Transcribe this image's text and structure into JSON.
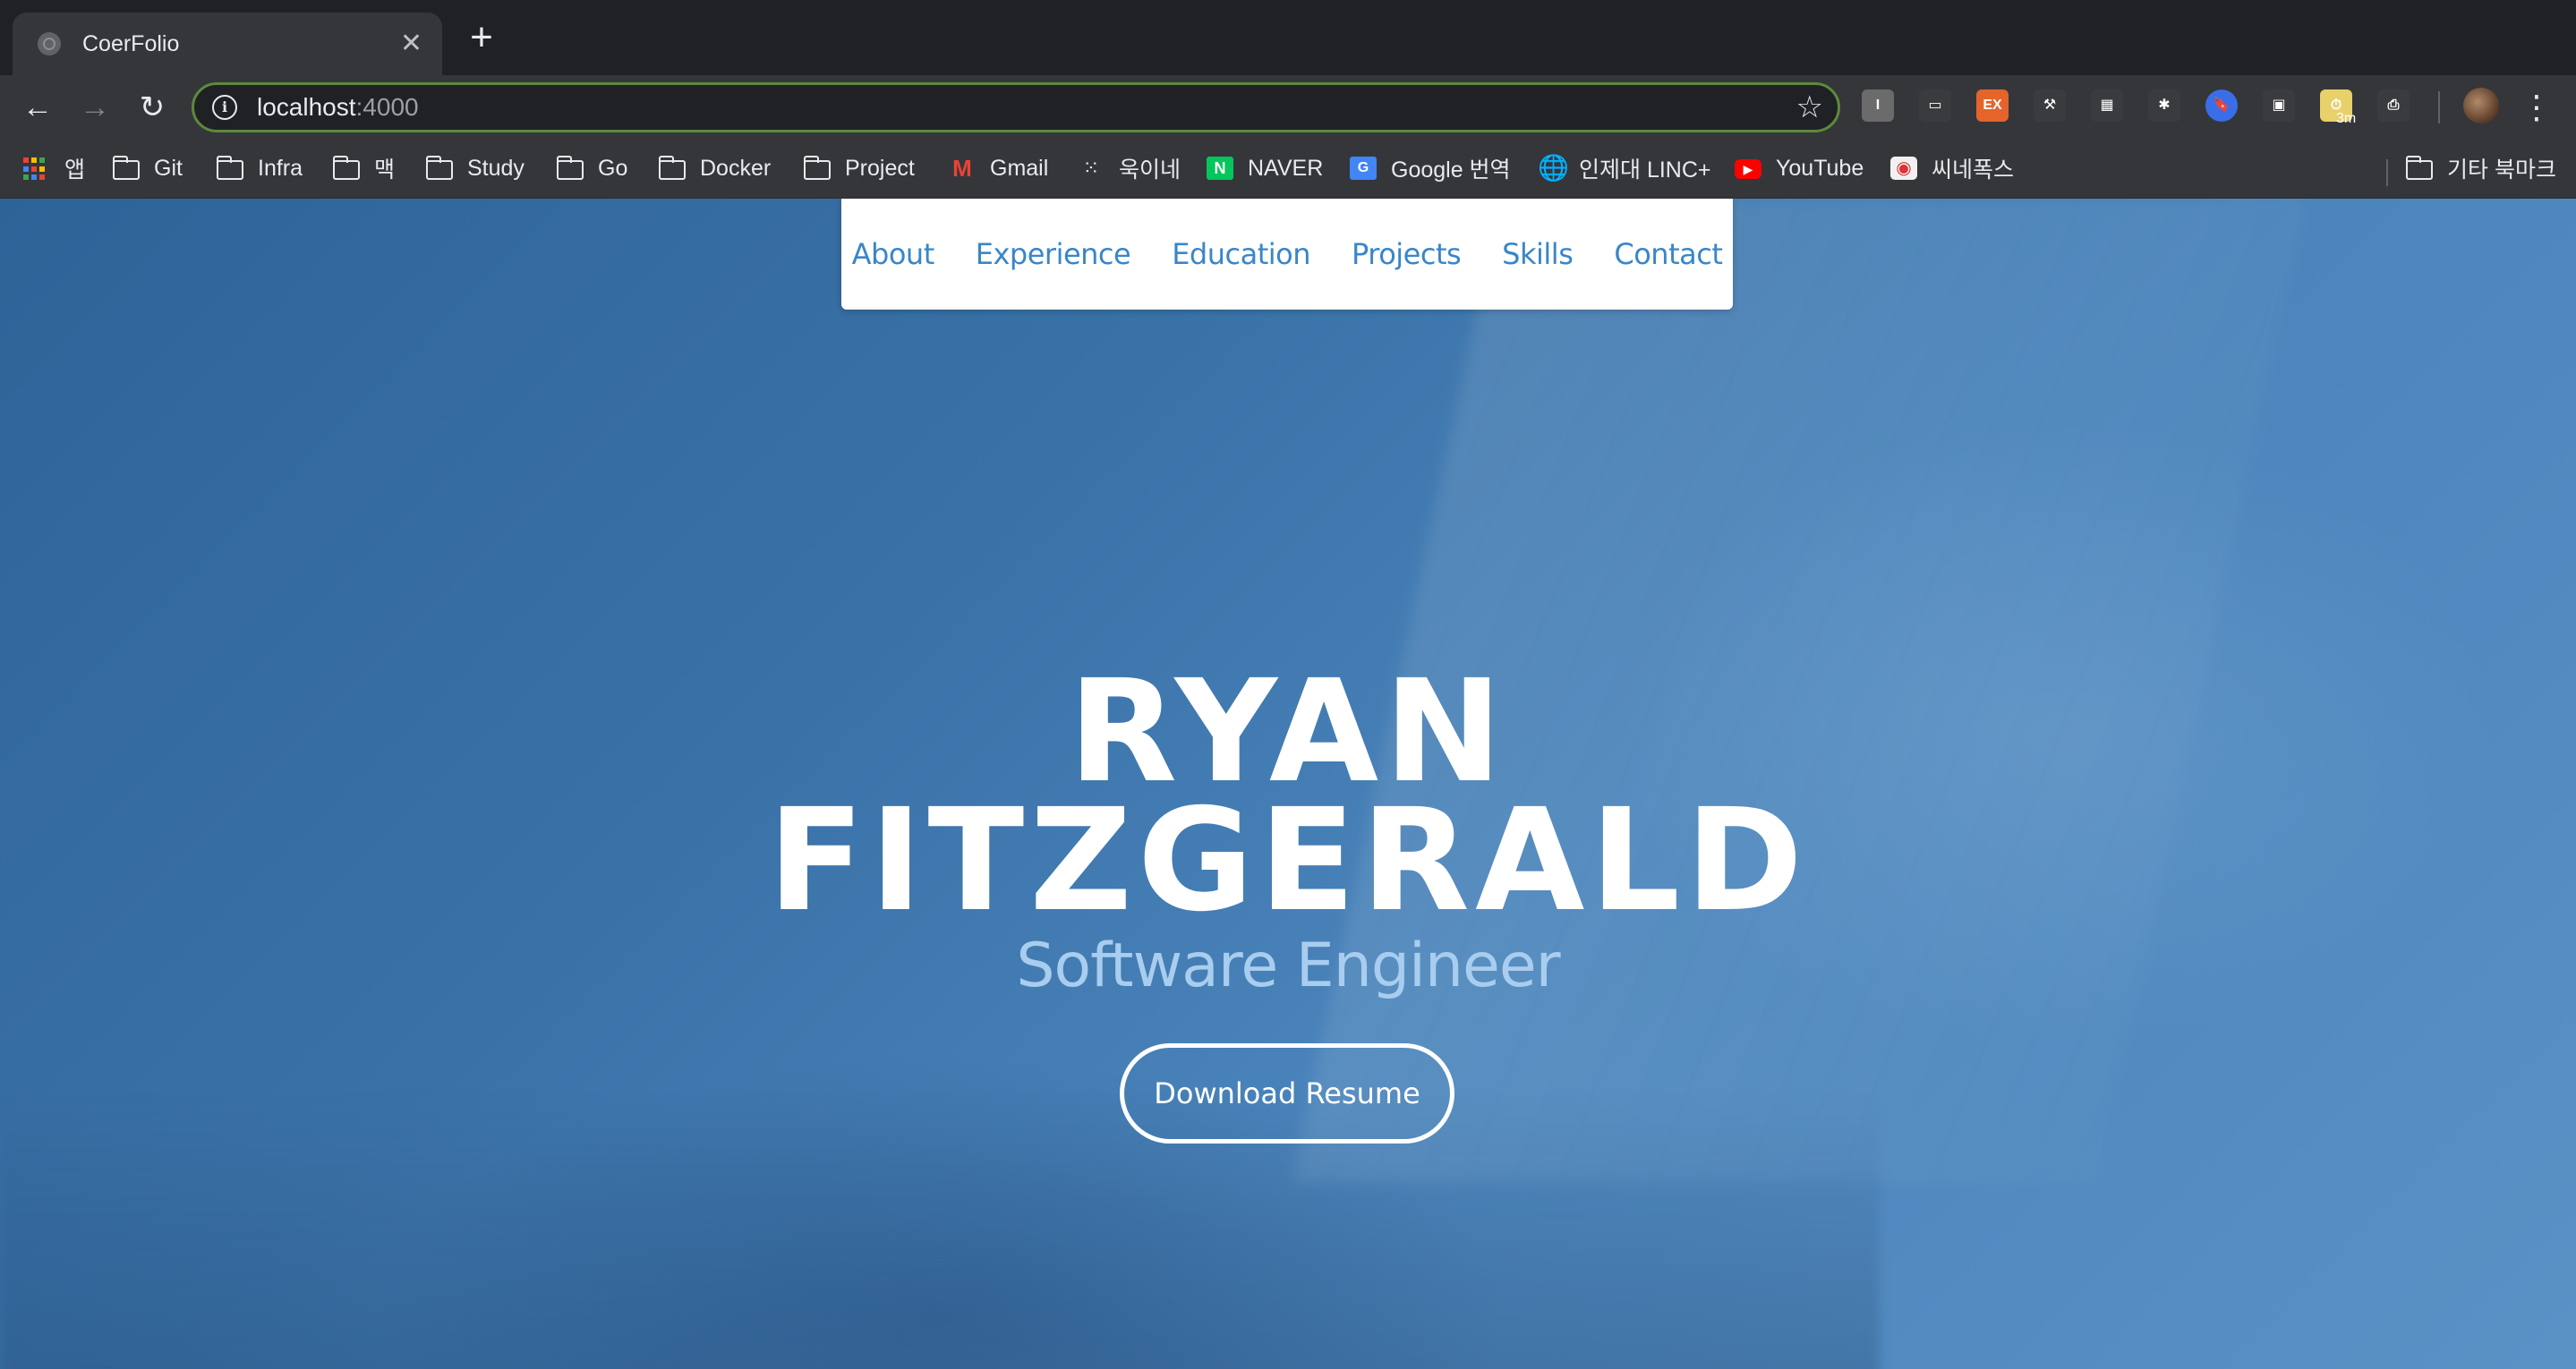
{
  "browser": {
    "tab": {
      "title": "CoerFolio",
      "close": "✕"
    },
    "new_tab": "+",
    "nav": {
      "back": "←",
      "forward": "→",
      "reload": "↻"
    },
    "address": {
      "host": "localhost",
      "port": ":4000",
      "info": "i",
      "star": "☆"
    },
    "extensions": [
      {
        "name": "i-ext-icon",
        "label": "I",
        "color": "#6b6b6b"
      },
      {
        "name": "screen-ext-icon",
        "label": "▭",
        "color": "#3a3b3e"
      },
      {
        "name": "ex-ext-icon",
        "label": "EX",
        "color": "#e4642a"
      },
      {
        "name": "tools-ext-icon",
        "label": "⚒",
        "color": "#3a3b3e"
      },
      {
        "name": "grid-ext-icon",
        "label": "▦",
        "color": "#3a3b3e"
      },
      {
        "name": "asterisk-ext-icon",
        "label": "✱",
        "color": "#3a3b3e"
      },
      {
        "name": "bookmark-ext-icon",
        "label": "🔖",
        "color": "#3a6ee8"
      },
      {
        "name": "image-ext-icon",
        "label": "▣",
        "color": "#3a3b3e"
      },
      {
        "name": "timer-ext-icon",
        "label": "⏱",
        "color": "#e8d06a",
        "badge": "3m"
      },
      {
        "name": "print-ext-icon",
        "label": "⎙",
        "color": "#3a3b3e"
      }
    ],
    "menu": "⋮",
    "bookmarks": [
      {
        "label": "앱",
        "icon": "apps-icon"
      },
      {
        "label": "Git",
        "icon": "folder-icon"
      },
      {
        "label": "Infra",
        "icon": "folder-icon"
      },
      {
        "label": "맥",
        "icon": "folder-icon"
      },
      {
        "label": "Study",
        "icon": "folder-icon"
      },
      {
        "label": "Go",
        "icon": "folder-icon"
      },
      {
        "label": "Docker",
        "icon": "folder-icon"
      },
      {
        "label": "Project",
        "icon": "folder-icon"
      },
      {
        "label": "Gmail",
        "icon": "gmail-icon"
      },
      {
        "label": "욱이네",
        "icon": "dots-icon"
      },
      {
        "label": "NAVER",
        "icon": "naver-icon"
      },
      {
        "label": "Google 번역",
        "icon": "translate-icon"
      },
      {
        "label": "인제대 LINC+",
        "icon": "globe-icon"
      },
      {
        "label": "YouTube",
        "icon": "youtube-icon"
      },
      {
        "label": "씨네폭스",
        "icon": "cinefox-icon"
      }
    ],
    "other_bookmarks": "기타 북마크"
  },
  "page": {
    "nav_links": [
      "About",
      "Experience",
      "Education",
      "Projects",
      "Skills",
      "Contact"
    ],
    "name_line1": "RYAN",
    "name_line2": "FITZGERALD",
    "title": "Software Engineer",
    "resume_button": "Download Resume"
  }
}
